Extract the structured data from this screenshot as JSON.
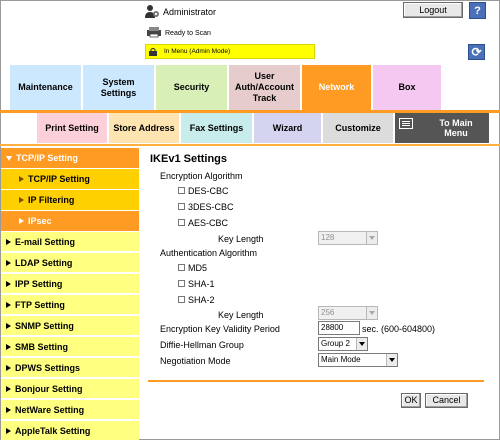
{
  "header": {
    "user": "Administrator",
    "logout": "Logout",
    "help": "?",
    "status": "Ready to Scan",
    "mode": "In Menu (Admin Mode)"
  },
  "tabs": [
    {
      "label": "Maintenance"
    },
    {
      "label": "System Settings"
    },
    {
      "label": "Security"
    },
    {
      "label": "User Auth/Account Track"
    },
    {
      "label": "Network",
      "active": true
    },
    {
      "label": "Box"
    }
  ],
  "subtabs": [
    {
      "label": "Print Setting"
    },
    {
      "label": "Store Address"
    },
    {
      "label": "Fax Settings"
    },
    {
      "label": "Wizard"
    },
    {
      "label": "Customize"
    },
    {
      "label": "To Main Menu"
    }
  ],
  "sidebar": {
    "items": [
      {
        "label": "TCP/IP Setting"
      },
      {
        "label": "TCP/IP Setting"
      },
      {
        "label": "IP Filtering"
      },
      {
        "label": "IPsec"
      },
      {
        "label": "E-mail Setting"
      },
      {
        "label": "LDAP Setting"
      },
      {
        "label": "IPP Setting"
      },
      {
        "label": "FTP Setting"
      },
      {
        "label": "SNMP Setting"
      },
      {
        "label": "SMB Setting"
      },
      {
        "label": "DPWS Settings"
      },
      {
        "label": "Bonjour Setting"
      },
      {
        "label": "NetWare Setting"
      },
      {
        "label": "AppleTalk Setting"
      }
    ]
  },
  "main": {
    "title": "IKEv1 Settings",
    "encryption": {
      "label": "Encryption Algorithm",
      "options": [
        "DES-CBC",
        "3DES-CBC",
        "AES-CBC"
      ],
      "key_length_label": "Key Length",
      "key_length_value": "128"
    },
    "authentication": {
      "label": "Authentication Algorithm",
      "options": [
        "MD5",
        "SHA-1",
        "SHA-2"
      ],
      "key_length_label": "Key Length",
      "key_length_value": "256"
    },
    "validity": {
      "label": "Encryption Key Validity Period",
      "value": "28800",
      "unit": "sec. (600-604800)"
    },
    "dh_group": {
      "label": "Diffie-Hellman Group",
      "value": "Group 2"
    },
    "negotiation": {
      "label": "Negotiation Mode",
      "value": "Main Mode"
    },
    "ok": "OK",
    "cancel": "Cancel"
  },
  "colors": {
    "accent": "#ff9a22",
    "sidebar_yellow": "#ffff80",
    "mode_bar": "#ffff00"
  }
}
